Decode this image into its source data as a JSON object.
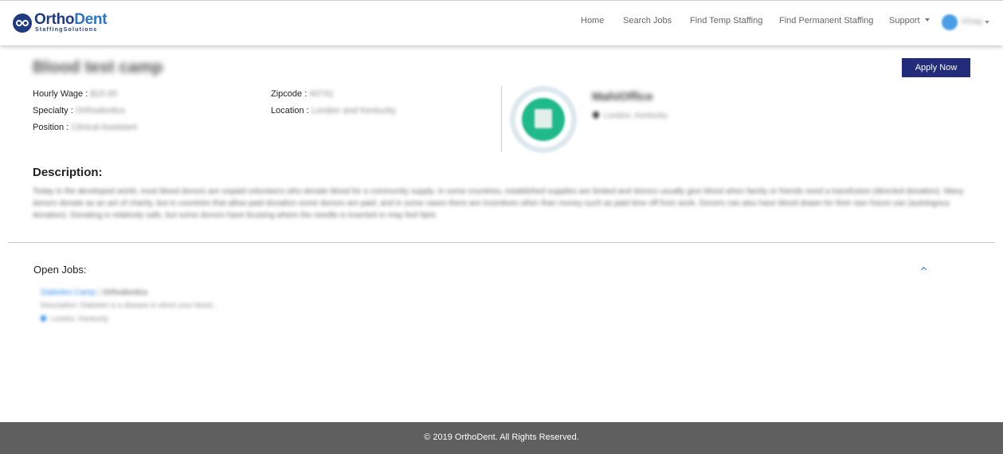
{
  "brand": {
    "name_part1": "Ortho",
    "name_part2": "Dent",
    "subtitle": "StaffingSolutions"
  },
  "nav": {
    "items": [
      "Home",
      "Search Jobs",
      "Find Temp Staffing",
      "Find Permanent Staffing"
    ],
    "support_label": "Support",
    "user_name": "Vinay"
  },
  "job": {
    "title": "Blood test camp",
    "apply_label": "Apply Now",
    "fields": {
      "hourly_wage_label": "Hourly Wage :",
      "hourly_wage_value": "$15.00",
      "specialty_label": "Specialty :",
      "specialty_value": "Orthodontics",
      "position_label": "Position :",
      "position_value": "Clinical Assistant",
      "zipcode_label": "Zipcode :",
      "zipcode_value": "40741",
      "location_label": "Location :",
      "location_value": "London and Kentucky"
    }
  },
  "office": {
    "name": "MahiOffice",
    "location": "London, Kentucky"
  },
  "description": {
    "heading": "Description:",
    "text": "Today in the developed world, most blood donors are unpaid volunteers who donate blood for a community supply. In some countries, established supplies are limited and donors usually give blood when family or friends need a transfusion (directed donation). Many donors donate as an act of charity, but in countries that allow paid donation some donors are paid, and in some cases there are incentives other than money such as paid time off from work. Donors can also have blood drawn for their own future use (autologous donation). Donating is relatively safe, but some donors have bruising where the needle is inserted or may feel faint."
  },
  "open_jobs": {
    "heading": "Open Jobs:",
    "items": [
      {
        "title": "Diabetes Camp",
        "specialty": "Orthodontics",
        "description": "Description: Diabetes is a disease in which your blood...",
        "location": "London, Kentucky"
      }
    ]
  },
  "footer": {
    "text": "© 2019 OrthoDent. All Rights Reserved."
  },
  "colors": {
    "brand_navy": "#1f3b82",
    "brand_blue": "#2d74c6",
    "apply_button": "#232c7a",
    "footer_bg": "#5f5f5f",
    "office_logo_green": "#1fb98a"
  }
}
